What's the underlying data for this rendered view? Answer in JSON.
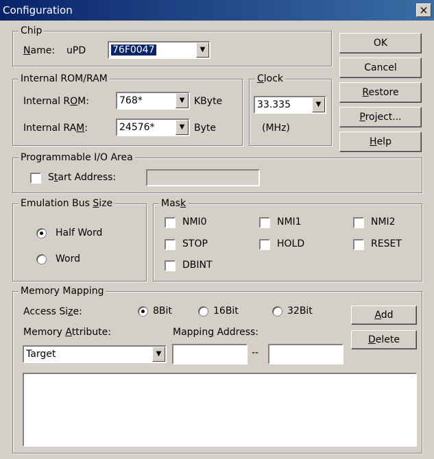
{
  "window": {
    "title": "Configuration",
    "close": "×"
  },
  "chip": {
    "legend": "Chip",
    "name_label": "Name:",
    "name_prefix": "uPD",
    "name_value": "76F0047"
  },
  "rom_ram": {
    "legend": "Internal ROM/RAM",
    "rom_label": "Internal ROM:",
    "rom_value": "768*",
    "rom_unit": "KByte",
    "ram_label": "Internal RAM:",
    "ram_value": "24576*",
    "ram_unit": "Byte"
  },
  "clock": {
    "legend": "Clock",
    "value": "33.335",
    "unit": "(MHz)"
  },
  "buttons": {
    "ok": "OK",
    "cancel": "Cancel",
    "restore": "Restore",
    "project": "Project...",
    "help": "Help"
  },
  "prog_io": {
    "legend": "Programmable I/O Area",
    "start_label": "Start Address:",
    "start_value": ""
  },
  "bus_size": {
    "legend": "Emulation Bus Size",
    "options": [
      {
        "label": "Half Word",
        "checked": true
      },
      {
        "label": "Word",
        "checked": false
      }
    ]
  },
  "mask": {
    "legend": "Mask",
    "items": [
      "NMI0",
      "NMI1",
      "NMI2",
      "STOP",
      "HOLD",
      "RESET",
      "DBINT"
    ]
  },
  "memory": {
    "legend": "Memory Mapping",
    "access_label": "Access Size:",
    "access_options": [
      {
        "label": "8Bit",
        "checked": true
      },
      {
        "label": "16Bit",
        "checked": false
      },
      {
        "label": "32Bit",
        "checked": false
      }
    ],
    "attr_label": "Memory Attribute:",
    "attr_value": "Target",
    "mapping_label": "Mapping Address:",
    "mapping_sep": "--",
    "add": "Add",
    "delete": "Delete"
  },
  "icons": {
    "dropdown": "chevron-down-icon",
    "close": "close-icon"
  },
  "colors": {
    "face": "#d4d0c8",
    "title_start": "#0a246a",
    "title_end": "#3a6ea5",
    "selection": "#0a246a"
  }
}
